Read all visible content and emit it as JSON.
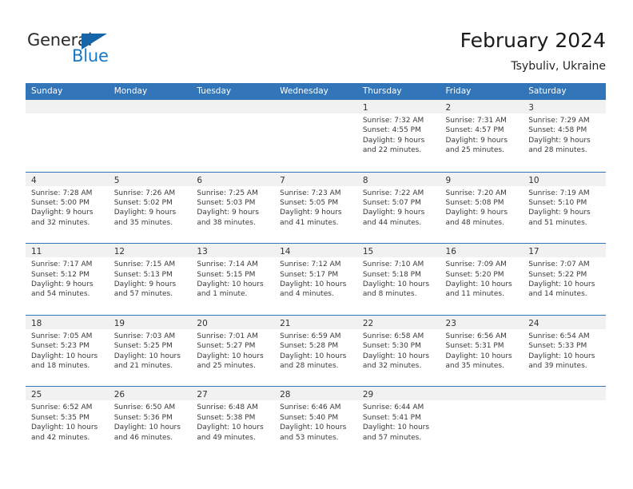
{
  "brand": {
    "name_dark": "General",
    "name_blue": "Blue",
    "accent_color": "#1878c8",
    "triangle_color": "#1565a8"
  },
  "header": {
    "title": "February 2024",
    "subtitle": "Tsybuliv, Ukraine"
  },
  "theme": {
    "header_blue": "#3275b9",
    "day_band_gray": "#f1f1f1",
    "text_color": "#3a3a3a"
  },
  "calendar": {
    "day_names": [
      "Sunday",
      "Monday",
      "Tuesday",
      "Wednesday",
      "Thursday",
      "Friday",
      "Saturday"
    ],
    "weeks": [
      [
        {
          "day": "",
          "lines": []
        },
        {
          "day": "",
          "lines": []
        },
        {
          "day": "",
          "lines": []
        },
        {
          "day": "",
          "lines": []
        },
        {
          "day": "1",
          "lines": [
            "Sunrise: 7:32 AM",
            "Sunset: 4:55 PM",
            "Daylight: 9 hours",
            "and 22 minutes."
          ]
        },
        {
          "day": "2",
          "lines": [
            "Sunrise: 7:31 AM",
            "Sunset: 4:57 PM",
            "Daylight: 9 hours",
            "and 25 minutes."
          ]
        },
        {
          "day": "3",
          "lines": [
            "Sunrise: 7:29 AM",
            "Sunset: 4:58 PM",
            "Daylight: 9 hours",
            "and 28 minutes."
          ]
        }
      ],
      [
        {
          "day": "4",
          "lines": [
            "Sunrise: 7:28 AM",
            "Sunset: 5:00 PM",
            "Daylight: 9 hours",
            "and 32 minutes."
          ]
        },
        {
          "day": "5",
          "lines": [
            "Sunrise: 7:26 AM",
            "Sunset: 5:02 PM",
            "Daylight: 9 hours",
            "and 35 minutes."
          ]
        },
        {
          "day": "6",
          "lines": [
            "Sunrise: 7:25 AM",
            "Sunset: 5:03 PM",
            "Daylight: 9 hours",
            "and 38 minutes."
          ]
        },
        {
          "day": "7",
          "lines": [
            "Sunrise: 7:23 AM",
            "Sunset: 5:05 PM",
            "Daylight: 9 hours",
            "and 41 minutes."
          ]
        },
        {
          "day": "8",
          "lines": [
            "Sunrise: 7:22 AM",
            "Sunset: 5:07 PM",
            "Daylight: 9 hours",
            "and 44 minutes."
          ]
        },
        {
          "day": "9",
          "lines": [
            "Sunrise: 7:20 AM",
            "Sunset: 5:08 PM",
            "Daylight: 9 hours",
            "and 48 minutes."
          ]
        },
        {
          "day": "10",
          "lines": [
            "Sunrise: 7:19 AM",
            "Sunset: 5:10 PM",
            "Daylight: 9 hours",
            "and 51 minutes."
          ]
        }
      ],
      [
        {
          "day": "11",
          "lines": [
            "Sunrise: 7:17 AM",
            "Sunset: 5:12 PM",
            "Daylight: 9 hours",
            "and 54 minutes."
          ]
        },
        {
          "day": "12",
          "lines": [
            "Sunrise: 7:15 AM",
            "Sunset: 5:13 PM",
            "Daylight: 9 hours",
            "and 57 minutes."
          ]
        },
        {
          "day": "13",
          "lines": [
            "Sunrise: 7:14 AM",
            "Sunset: 5:15 PM",
            "Daylight: 10 hours",
            "and 1 minute."
          ]
        },
        {
          "day": "14",
          "lines": [
            "Sunrise: 7:12 AM",
            "Sunset: 5:17 PM",
            "Daylight: 10 hours",
            "and 4 minutes."
          ]
        },
        {
          "day": "15",
          "lines": [
            "Sunrise: 7:10 AM",
            "Sunset: 5:18 PM",
            "Daylight: 10 hours",
            "and 8 minutes."
          ]
        },
        {
          "day": "16",
          "lines": [
            "Sunrise: 7:09 AM",
            "Sunset: 5:20 PM",
            "Daylight: 10 hours",
            "and 11 minutes."
          ]
        },
        {
          "day": "17",
          "lines": [
            "Sunrise: 7:07 AM",
            "Sunset: 5:22 PM",
            "Daylight: 10 hours",
            "and 14 minutes."
          ]
        }
      ],
      [
        {
          "day": "18",
          "lines": [
            "Sunrise: 7:05 AM",
            "Sunset: 5:23 PM",
            "Daylight: 10 hours",
            "and 18 minutes."
          ]
        },
        {
          "day": "19",
          "lines": [
            "Sunrise: 7:03 AM",
            "Sunset: 5:25 PM",
            "Daylight: 10 hours",
            "and 21 minutes."
          ]
        },
        {
          "day": "20",
          "lines": [
            "Sunrise: 7:01 AM",
            "Sunset: 5:27 PM",
            "Daylight: 10 hours",
            "and 25 minutes."
          ]
        },
        {
          "day": "21",
          "lines": [
            "Sunrise: 6:59 AM",
            "Sunset: 5:28 PM",
            "Daylight: 10 hours",
            "and 28 minutes."
          ]
        },
        {
          "day": "22",
          "lines": [
            "Sunrise: 6:58 AM",
            "Sunset: 5:30 PM",
            "Daylight: 10 hours",
            "and 32 minutes."
          ]
        },
        {
          "day": "23",
          "lines": [
            "Sunrise: 6:56 AM",
            "Sunset: 5:31 PM",
            "Daylight: 10 hours",
            "and 35 minutes."
          ]
        },
        {
          "day": "24",
          "lines": [
            "Sunrise: 6:54 AM",
            "Sunset: 5:33 PM",
            "Daylight: 10 hours",
            "and 39 minutes."
          ]
        }
      ],
      [
        {
          "day": "25",
          "lines": [
            "Sunrise: 6:52 AM",
            "Sunset: 5:35 PM",
            "Daylight: 10 hours",
            "and 42 minutes."
          ]
        },
        {
          "day": "26",
          "lines": [
            "Sunrise: 6:50 AM",
            "Sunset: 5:36 PM",
            "Daylight: 10 hours",
            "and 46 minutes."
          ]
        },
        {
          "day": "27",
          "lines": [
            "Sunrise: 6:48 AM",
            "Sunset: 5:38 PM",
            "Daylight: 10 hours",
            "and 49 minutes."
          ]
        },
        {
          "day": "28",
          "lines": [
            "Sunrise: 6:46 AM",
            "Sunset: 5:40 PM",
            "Daylight: 10 hours",
            "and 53 minutes."
          ]
        },
        {
          "day": "29",
          "lines": [
            "Sunrise: 6:44 AM",
            "Sunset: 5:41 PM",
            "Daylight: 10 hours",
            "and 57 minutes."
          ]
        },
        {
          "day": "",
          "lines": []
        },
        {
          "day": "",
          "lines": []
        }
      ]
    ]
  }
}
